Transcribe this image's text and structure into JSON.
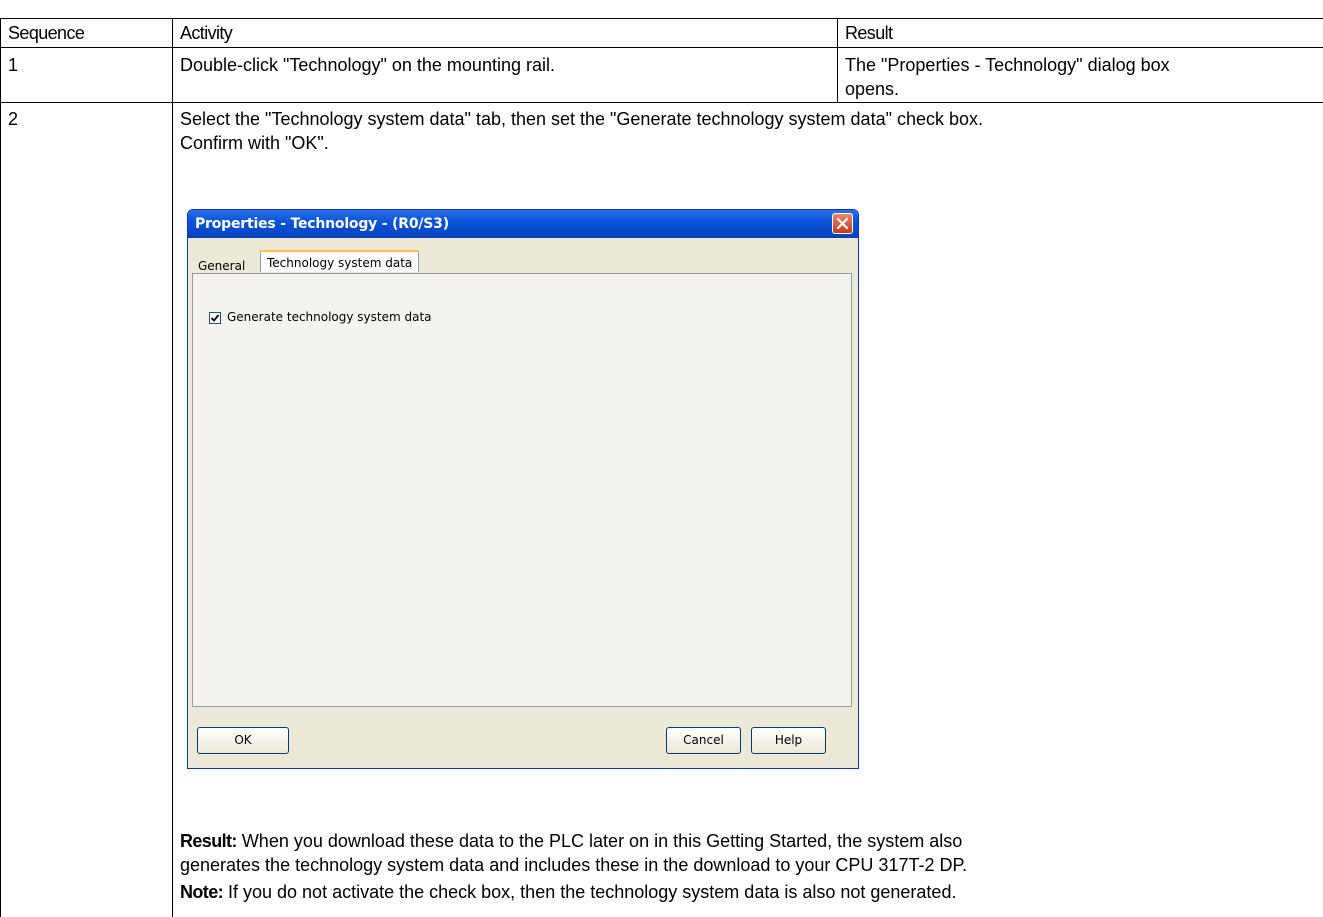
{
  "table": {
    "headers": {
      "sequence": "Sequence",
      "activity": "Activity",
      "result": "Result"
    },
    "row1": {
      "sequence": "1",
      "activity": "Double-click \"Technology\" on the mounting rail.",
      "result_line1": "The \"Properties - Technology\" dialog box",
      "result_line2": "opens."
    },
    "row2": {
      "sequence": "2",
      "activity_line1": "Select the \"Technology system data\" tab, then set the \"Generate technology system data\" check box.",
      "activity_line2": "Confirm with \"OK\".",
      "result_label": "Result:",
      "result_text_line1": " When you download these data to the PLC later on in this Getting Started, the system also",
      "result_text_line2": "generates the technology system data and includes these in the download to your CPU 317T-2 DP.",
      "note_label": "Note:",
      "note_text": " If you do not activate the check box, then the technology system data is also not generated."
    }
  },
  "dialog": {
    "title": "Properties - Technology - (R0/S3)",
    "tabs": {
      "general": "General",
      "active": "Technology system data"
    },
    "checkbox_label": "Generate technology system data",
    "checkbox_checked": true,
    "buttons": {
      "ok": "OK",
      "cancel": "Cancel",
      "help": "Help"
    }
  }
}
